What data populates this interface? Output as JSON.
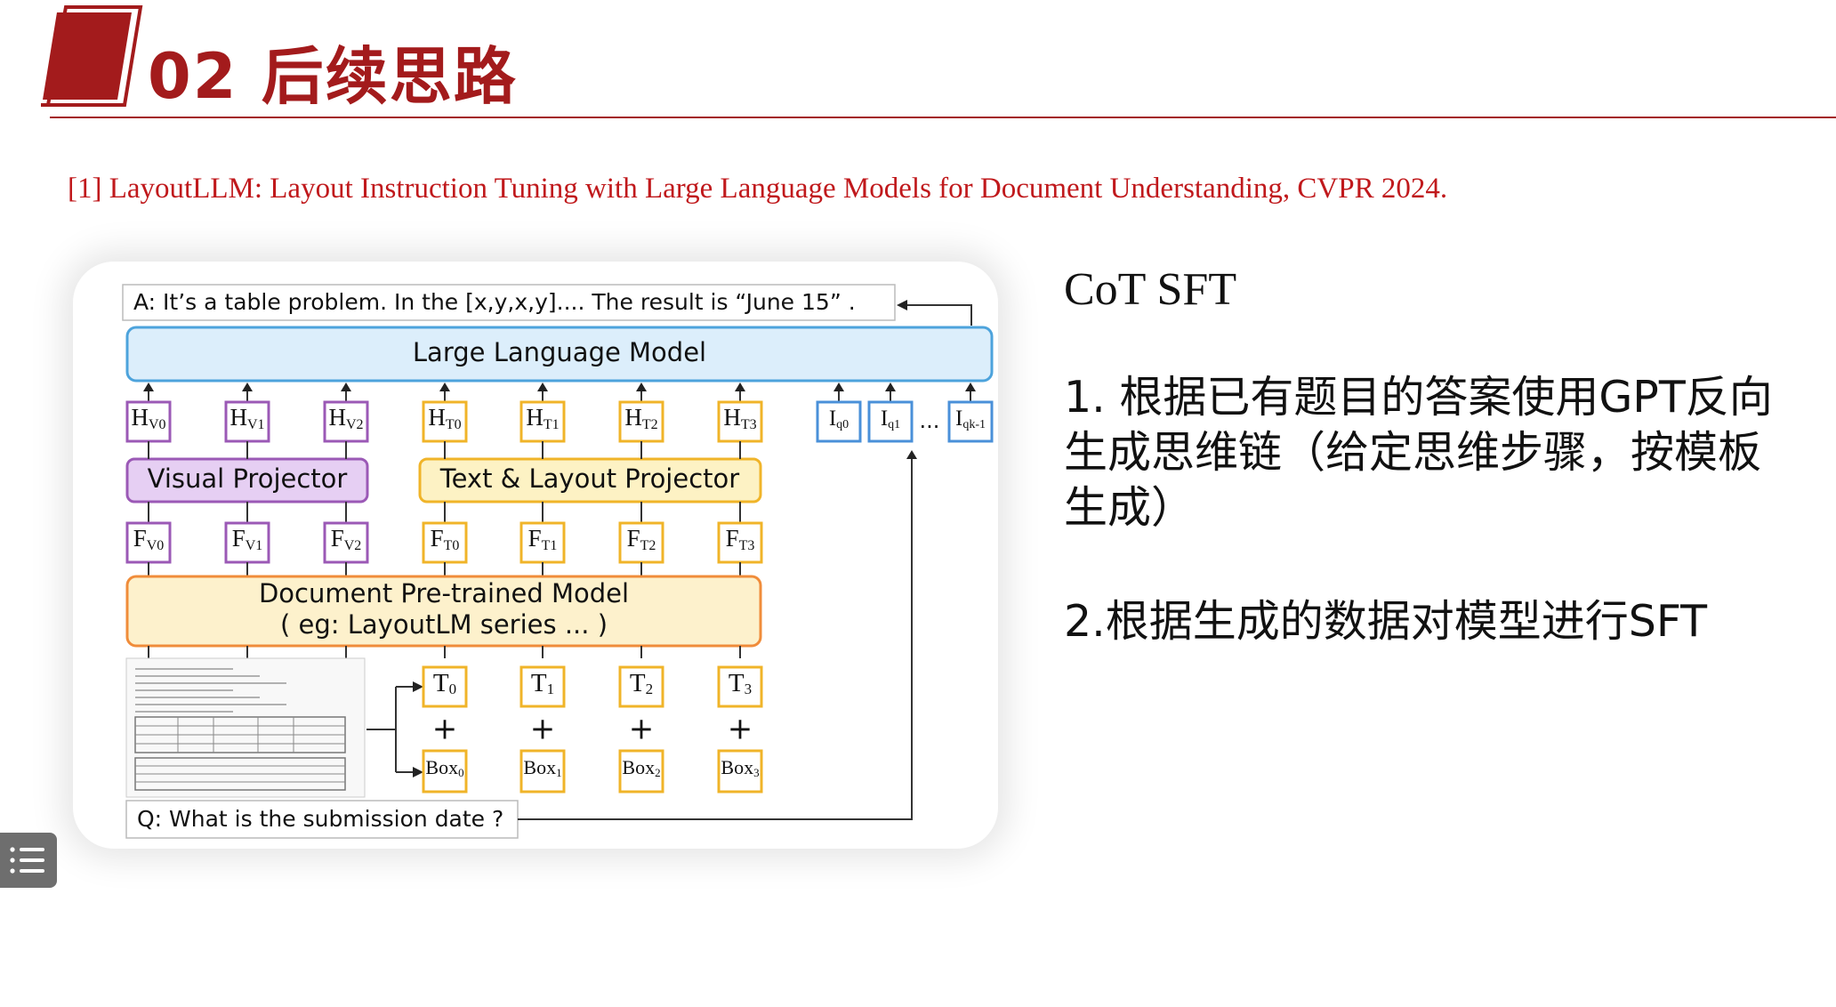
{
  "slide": {
    "title": "02 后续思路",
    "reference": "[1] LayoutLLM: Layout Instruction Tuning with Large Language Models for Document Understanding,  CVPR 2024.",
    "accent_color": "#a31b1c"
  },
  "diagram": {
    "answer": "A: It’s a table problem. In the [x,y,x,y].... The result is   “June 15” .",
    "llm": "Large Language Model",
    "visual_projector": "Visual Projector",
    "text_layout_projector": "Text & Layout Projector",
    "doc_model_line1": "Document Pre-trained Model",
    "doc_model_line2": "( eg: LayoutLM series ... )",
    "question": "Q: What is the submission date ?",
    "ellipsis": "...",
    "plus": "+",
    "hv": [
      {
        "m": "H",
        "s": "V0"
      },
      {
        "m": "H",
        "s": "V1"
      },
      {
        "m": "H",
        "s": "V2"
      }
    ],
    "ht": [
      {
        "m": "H",
        "s": "T0"
      },
      {
        "m": "H",
        "s": "T1"
      },
      {
        "m": "H",
        "s": "T2"
      },
      {
        "m": "H",
        "s": "T3"
      }
    ],
    "iq": [
      {
        "m": "I",
        "s": "q0"
      },
      {
        "m": "I",
        "s": "q1"
      },
      {
        "m": "I",
        "s": "qk-1"
      }
    ],
    "fv": [
      {
        "m": "F",
        "s": "V0"
      },
      {
        "m": "F",
        "s": "V1"
      },
      {
        "m": "F",
        "s": "V2"
      }
    ],
    "ft": [
      {
        "m": "F",
        "s": "T0"
      },
      {
        "m": "F",
        "s": "T1"
      },
      {
        "m": "F",
        "s": "T2"
      },
      {
        "m": "F",
        "s": "T3"
      }
    ],
    "t": [
      {
        "m": "T",
        "s": "0"
      },
      {
        "m": "T",
        "s": "1"
      },
      {
        "m": "T",
        "s": "2"
      },
      {
        "m": "T",
        "s": "3"
      }
    ],
    "box": [
      {
        "m": "Box",
        "s": "0"
      },
      {
        "m": "Box",
        "s": "1"
      },
      {
        "m": "Box",
        "s": "2"
      },
      {
        "m": "Box",
        "s": "3"
      }
    ],
    "colors": {
      "llm_fill": "#dceefb",
      "llm_stroke": "#4da3dc",
      "purple_fill": "#e6cff3",
      "purple_stroke": "#9b59b6",
      "yellow_fill": "#fdf2c4",
      "yellow_stroke": "#f0b429",
      "doc_fill": "#fdf1cc",
      "doc_stroke": "#f08c3a",
      "blue_stroke": "#4a90d9"
    }
  },
  "notes": {
    "heading": "CoT SFT",
    "step1": "1. 根据已有题目的答案使用GPT反向生成思维链（给定思维步骤，按模板生成）",
    "step2": "2.根据生成的数据对模型进行SFT"
  },
  "ui": {
    "menu_icon": "list-menu-icon"
  }
}
